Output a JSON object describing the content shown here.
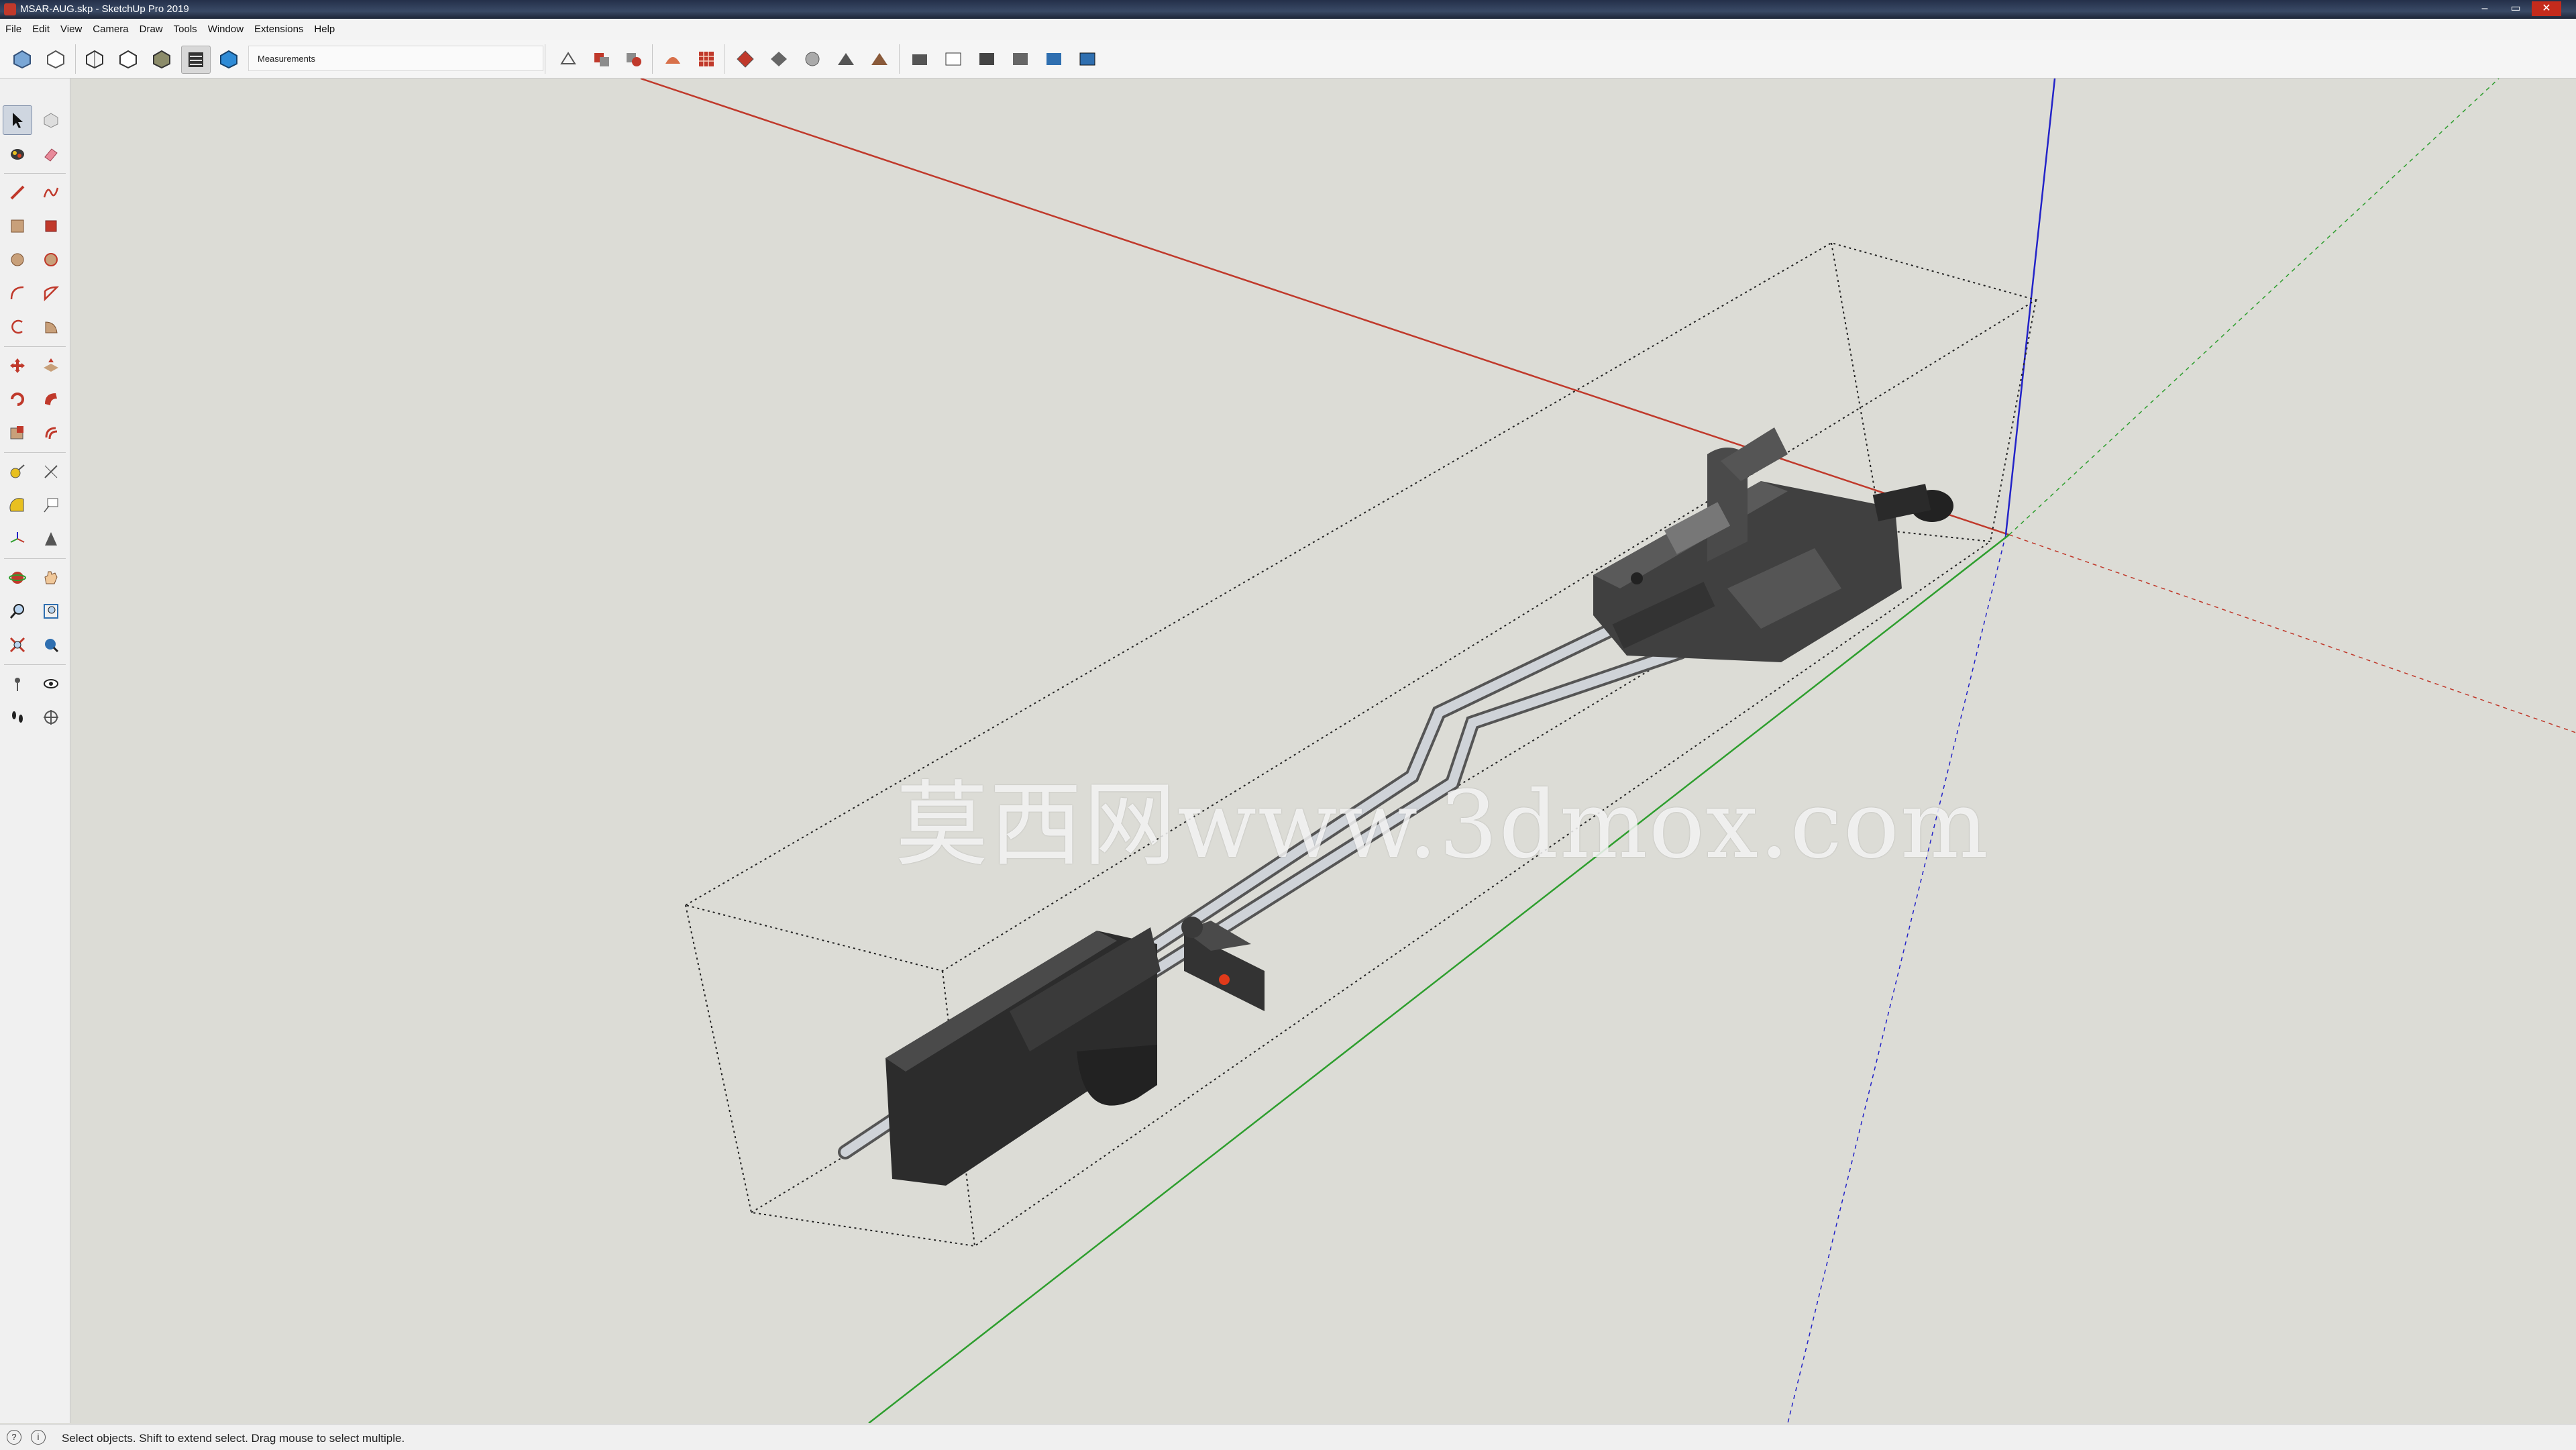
{
  "window": {
    "title": "MSAR-AUG.skp - SketchUp Pro 2019",
    "minimize": "–",
    "maximize": "▭",
    "close": "✕"
  },
  "menus": [
    "File",
    "Edit",
    "View",
    "Camera",
    "Draw",
    "Tools",
    "Window",
    "Extensions",
    "Help"
  ],
  "toolbar": {
    "measurements_label": "Measurements",
    "measurements_value": ""
  },
  "viewport": {
    "watermark": "莫西网www.3dmox.com"
  },
  "status": {
    "text": "Select objects. Shift to extend select. Drag mouse to select multiple."
  },
  "colors": {
    "red_axis": "#c0392b",
    "green_axis": "#2e9e2e",
    "blue_axis": "#2323c8",
    "background": "#dcdcd6",
    "model_dark": "#3a3a3a",
    "model_light": "#7a7a7a"
  },
  "tools": {
    "left_palette": [
      "select-tool",
      "component-tool",
      "paint-bucket-tool",
      "eraser-tool",
      "line-tool",
      "freehand-tool",
      "rectangle-tool",
      "rotated-rectangle-tool",
      "circle-tool",
      "polygon-tool",
      "arc-tool",
      "two-point-arc-tool",
      "three-point-arc-tool",
      "pie-tool",
      "move-tool",
      "push-pull-tool",
      "rotate-tool",
      "follow-me-tool",
      "scale-tool",
      "offset-tool",
      "tape-measure-tool",
      "dimension-tool",
      "protractor-tool",
      "text-tool",
      "axes-tool",
      "3d-text-tool",
      "orbit-tool",
      "pan-tool",
      "zoom-tool",
      "zoom-window-tool",
      "zoom-extents-tool",
      "previous-view-tool",
      "position-camera-tool",
      "look-around-tool",
      "walk-tool",
      "section-plane-tool"
    ]
  }
}
